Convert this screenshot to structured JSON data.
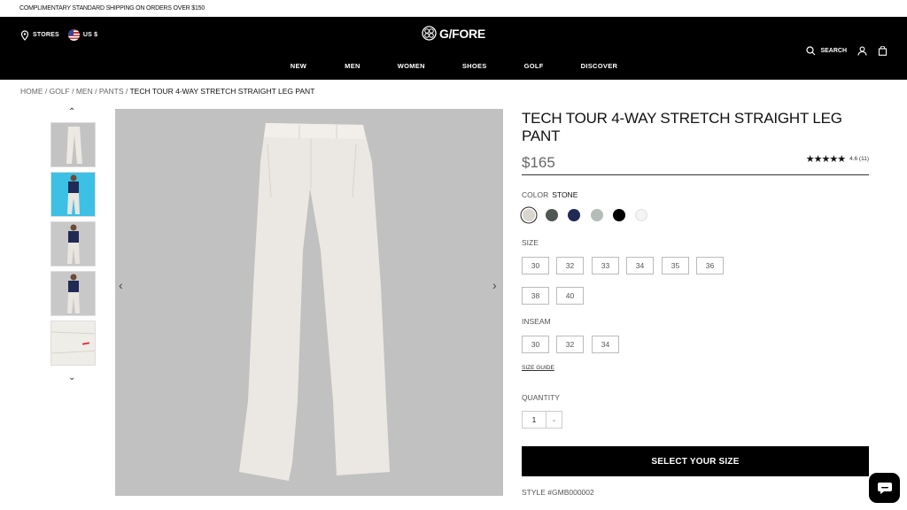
{
  "promo": "COMPLIMENTARY STANDARD SHIPPING ON ORDERS OVER $150",
  "header": {
    "stores": "STORES",
    "currency": "US $",
    "logo": "G/FORE",
    "search": "SEARCH"
  },
  "nav": [
    "NEW",
    "MEN",
    "WOMEN",
    "SHOES",
    "GOLF",
    "DISCOVER"
  ],
  "breadcrumb": {
    "items": [
      "HOME",
      "GOLF",
      "MEN",
      "PANTS"
    ],
    "current": "TECH TOUR 4-WAY STRETCH STRAIGHT LEG PANT"
  },
  "product": {
    "title": "TECH TOUR 4-WAY STRETCH STRAIGHT LEG PANT",
    "price": "$165",
    "rating_text": "4.6 (11)",
    "rating_value": 4.6,
    "stars": "★★★★★",
    "color_label": "COLOR",
    "color_value": "STONE",
    "swatches": [
      "#d9d5cf",
      "#4f5753",
      "#1f2b55",
      "#b5bdb9",
      "#000000",
      "#f4f4f2"
    ],
    "size_label": "SIZE",
    "sizes": [
      "30",
      "32",
      "33",
      "34",
      "35",
      "36",
      "38",
      "40"
    ],
    "inseam_label": "INSEAM",
    "inseams": [
      "30",
      "32",
      "34"
    ],
    "size_guide": "SIZE GUIDE",
    "quantity_label": "QUANTITY",
    "quantity": "1",
    "cta": "SELECT YOUR SIZE",
    "style": "STYLE #GMB000002"
  },
  "icons": {
    "thumb_up": "⌃",
    "thumb_down": "⌄",
    "img_prev": "‹",
    "img_next": "›",
    "qty_chevron": "⌄"
  }
}
